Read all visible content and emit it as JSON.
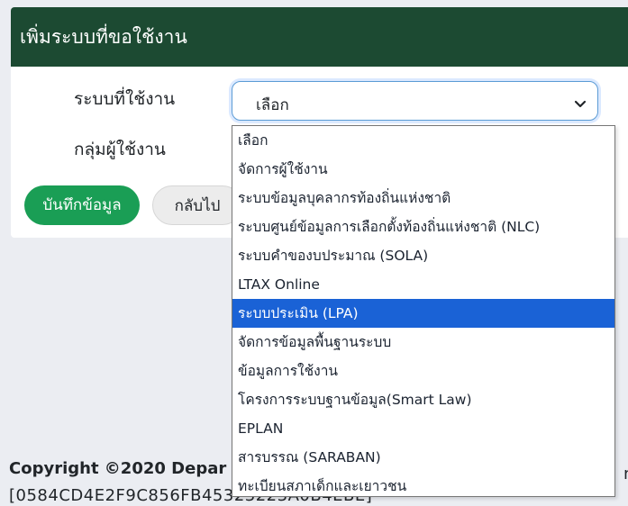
{
  "card": {
    "title": "เพิ่มระบบที่ขอใช้งาน",
    "system_label": "ระบบที่ใช้งาน",
    "group_label": "กลุ่มผู้ใช้งาน",
    "system_select_value": "เลือก",
    "save_label": "บันทึกข้อมูล",
    "back_label": "กลับไป"
  },
  "dropdown": {
    "options": [
      "เลือก",
      "จัดการผู้ใช้งาน",
      "ระบบข้อมูลบุคลากรท้องถิ่นแห่งชาติ",
      "ระบบศูนย์ข้อมูลการเลือกตั้งท้องถิ่นแห่งชาติ (NLC)",
      "ระบบคำของบประมาณ (SOLA)",
      "LTAX Online",
      "ระบบประเมิน (LPA)",
      "จัดการข้อมูลพื้นฐานระบบ",
      "ข้อมูลการใช้งาน",
      "โครงการระบบฐานข้อมูล(Smart Law)",
      "EPLAN",
      "สารบรรณ (SARABAN)",
      "ทะเบียนสภาเด็กและเยาวชน"
    ],
    "selected_index": 6
  },
  "footer": {
    "copyright": "Copyright ©2020 Depar",
    "trailing": "n",
    "hash": "[0584CD4E2F9C856FB45323223A0B4EBE]"
  },
  "colors": {
    "header_bg": "#1c4a32",
    "save_button": "#1a9e55",
    "selected_option": "#1a62d6",
    "page_bg": "#ebedf2"
  }
}
